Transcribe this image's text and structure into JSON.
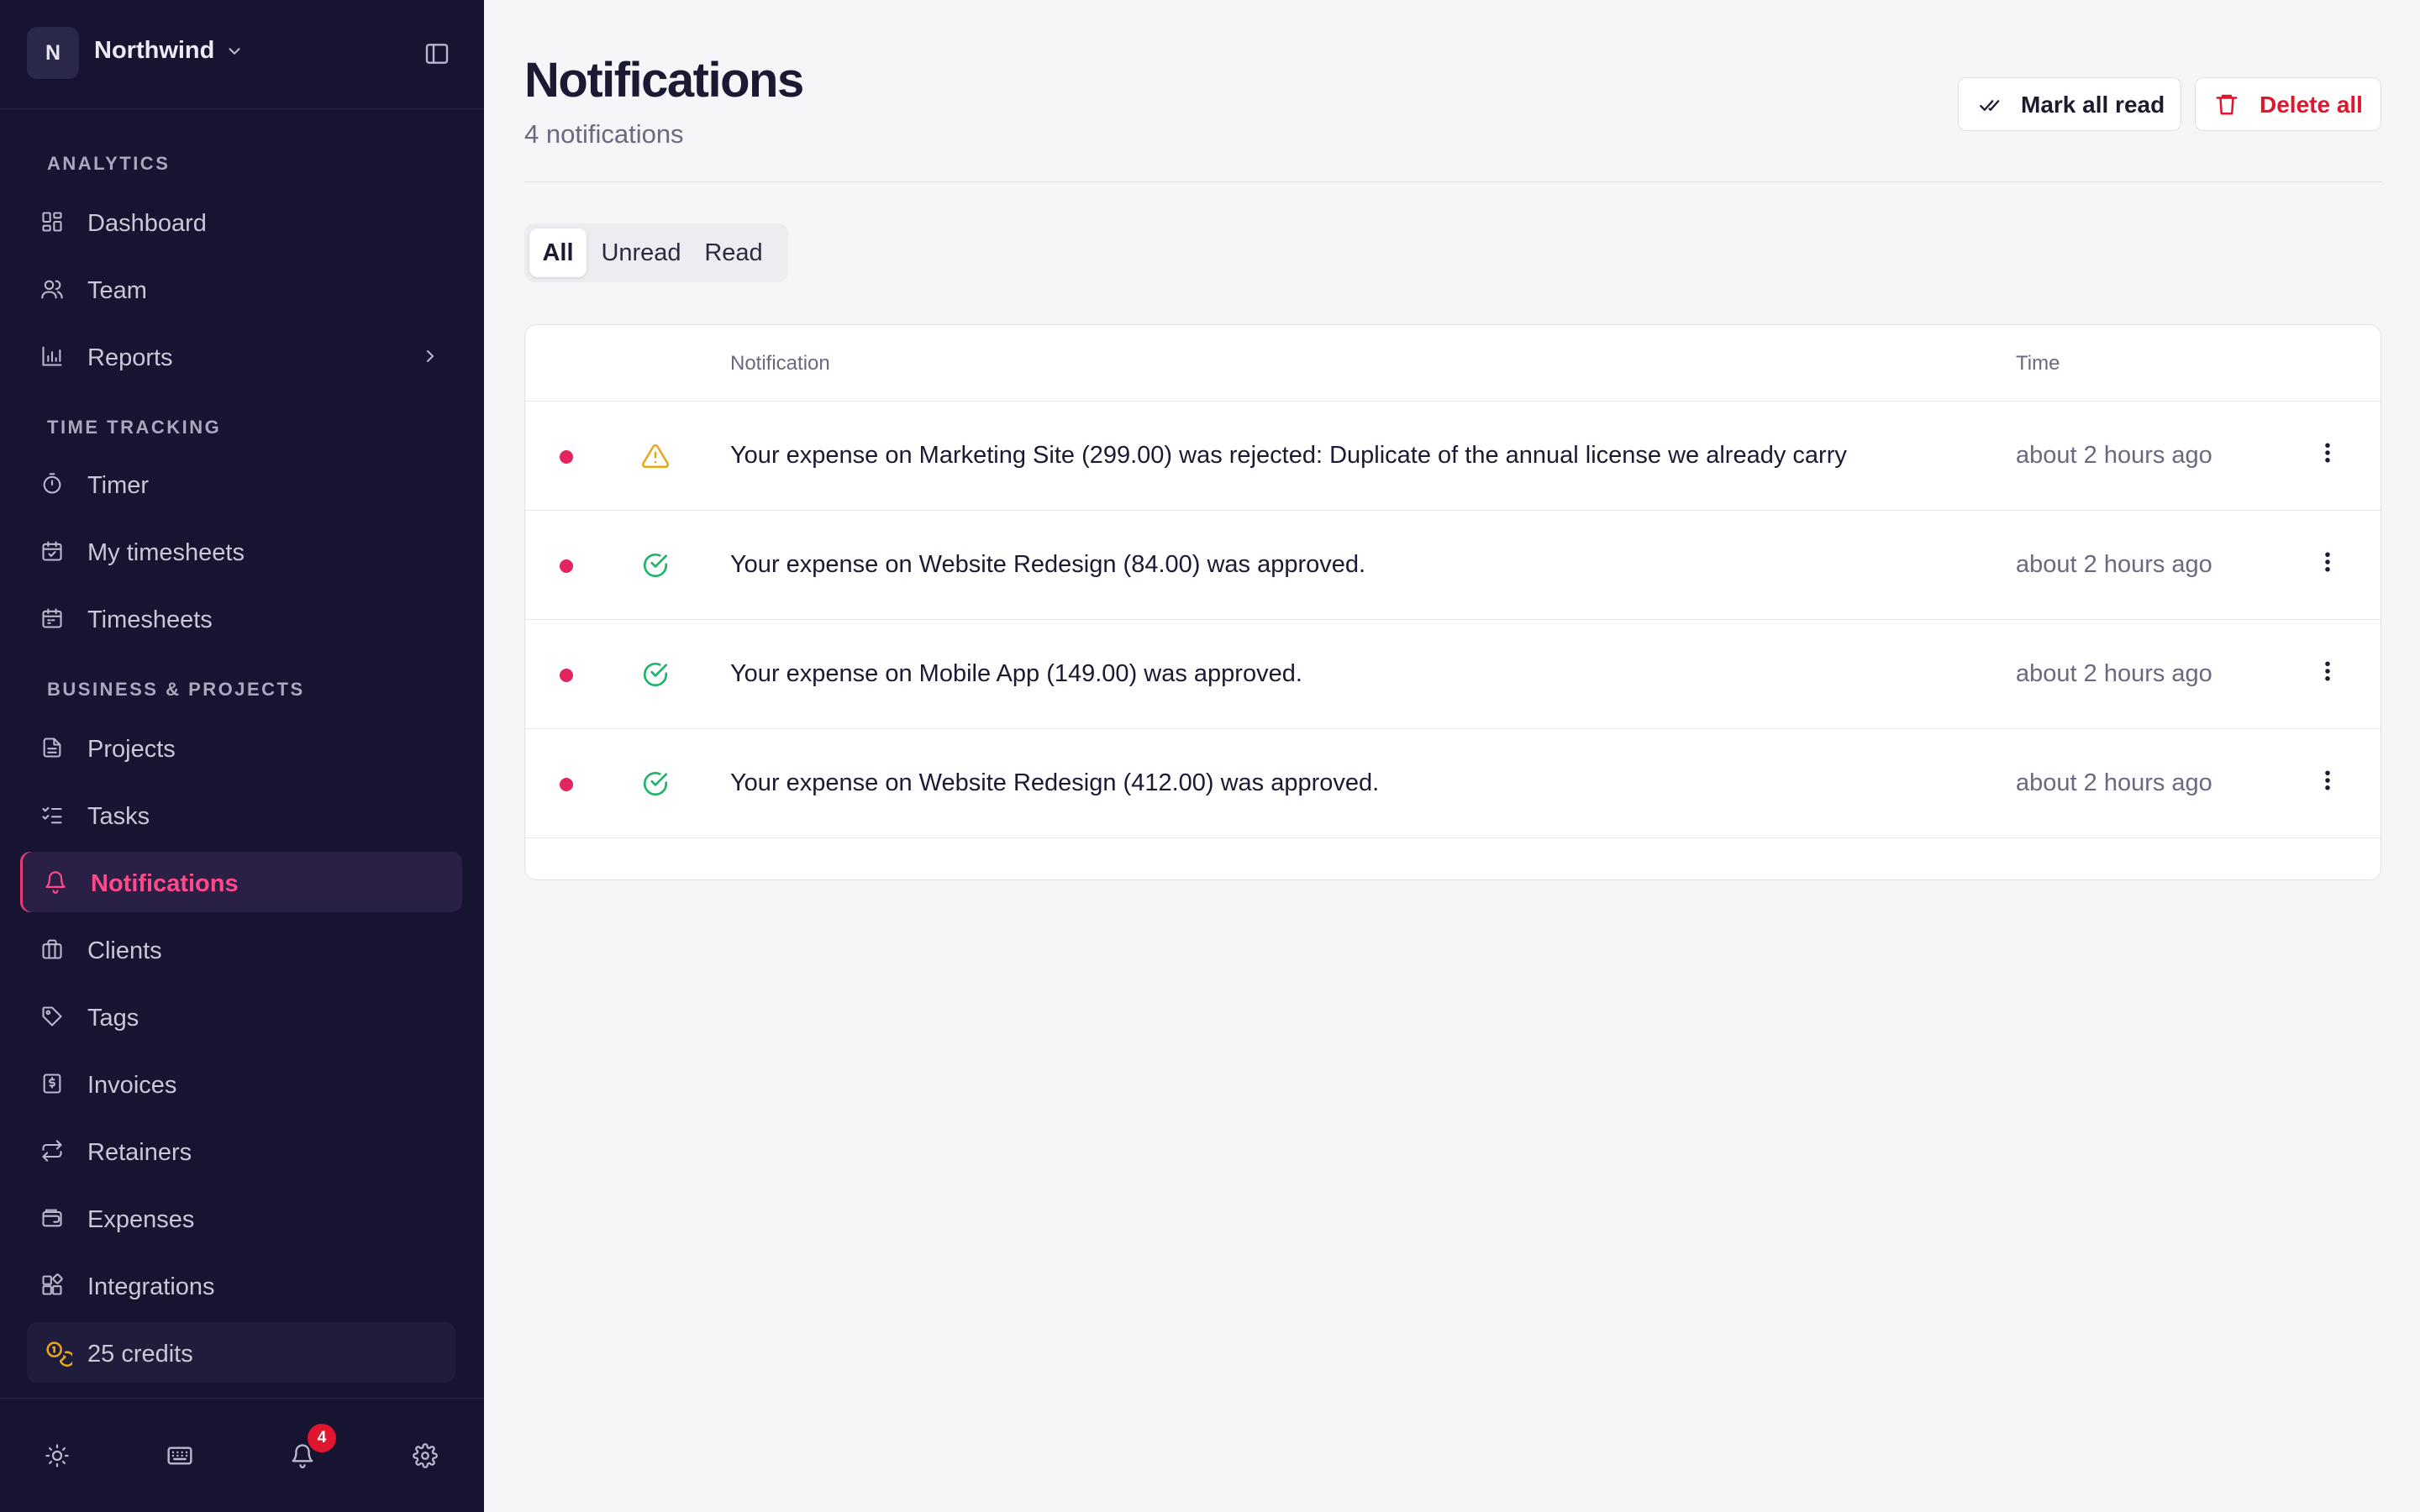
{
  "workspace": {
    "initial": "N",
    "name": "Northwind"
  },
  "sidebar": {
    "sections": [
      {
        "label": "ANALYTICS"
      },
      {
        "label": "TIME TRACKING"
      },
      {
        "label": "BUSINESS & PROJECTS"
      }
    ],
    "items": [
      {
        "label": "Dashboard",
        "icon": "dashboard-icon"
      },
      {
        "label": "Team",
        "icon": "users-icon"
      },
      {
        "label": "Reports",
        "icon": "bar-chart-icon"
      },
      {
        "label": "Timer",
        "icon": "stopwatch-icon"
      },
      {
        "label": "My timesheets",
        "icon": "calendar-icon"
      },
      {
        "label": "Timesheets",
        "icon": "calendar-icon"
      },
      {
        "label": "Projects",
        "icon": "document-icon"
      },
      {
        "label": "Tasks",
        "icon": "checklist-icon"
      },
      {
        "label": "Notifications",
        "icon": "bell-icon",
        "active": true
      },
      {
        "label": "Clients",
        "icon": "briefcase-icon"
      },
      {
        "label": "Tags",
        "icon": "tag-icon"
      },
      {
        "label": "Invoices",
        "icon": "invoice-icon"
      },
      {
        "label": "Retainers",
        "icon": "repeat-icon"
      },
      {
        "label": "Expenses",
        "icon": "wallet-icon"
      },
      {
        "label": "Integrations",
        "icon": "integrations-icon"
      }
    ],
    "credits": "25 credits",
    "footer": {
      "notification_count": "4"
    }
  },
  "page": {
    "title": "Notifications",
    "subtitle": "4 notifications",
    "mark_all_read": "Mark all read",
    "delete_all": "Delete all"
  },
  "tabs": [
    {
      "label": "All",
      "active": true
    },
    {
      "label": "Unread"
    },
    {
      "label": "Read"
    }
  ],
  "table": {
    "columns": [
      "Notification",
      "Time"
    ],
    "rows": [
      {
        "status": "warning",
        "unread": true,
        "text": "Your expense on Marketing Site (299.00) was rejected: Duplicate of the annual license we already carry",
        "time": "about 2 hours ago"
      },
      {
        "status": "approved",
        "unread": true,
        "text": "Your expense on Website Redesign (84.00) was approved.",
        "time": "about 2 hours ago"
      },
      {
        "status": "approved",
        "unread": true,
        "text": "Your expense on Mobile App (149.00) was approved.",
        "time": "about 2 hours ago"
      },
      {
        "status": "approved",
        "unread": true,
        "text": "Your expense on Website Redesign (412.00) was approved.",
        "time": "about 2 hours ago"
      }
    ]
  },
  "colors": {
    "sidebar_bg": "#161430",
    "accent": "#e83a78",
    "danger": "#e0162f",
    "warning": "#e9a81c",
    "success": "#22b36b"
  }
}
